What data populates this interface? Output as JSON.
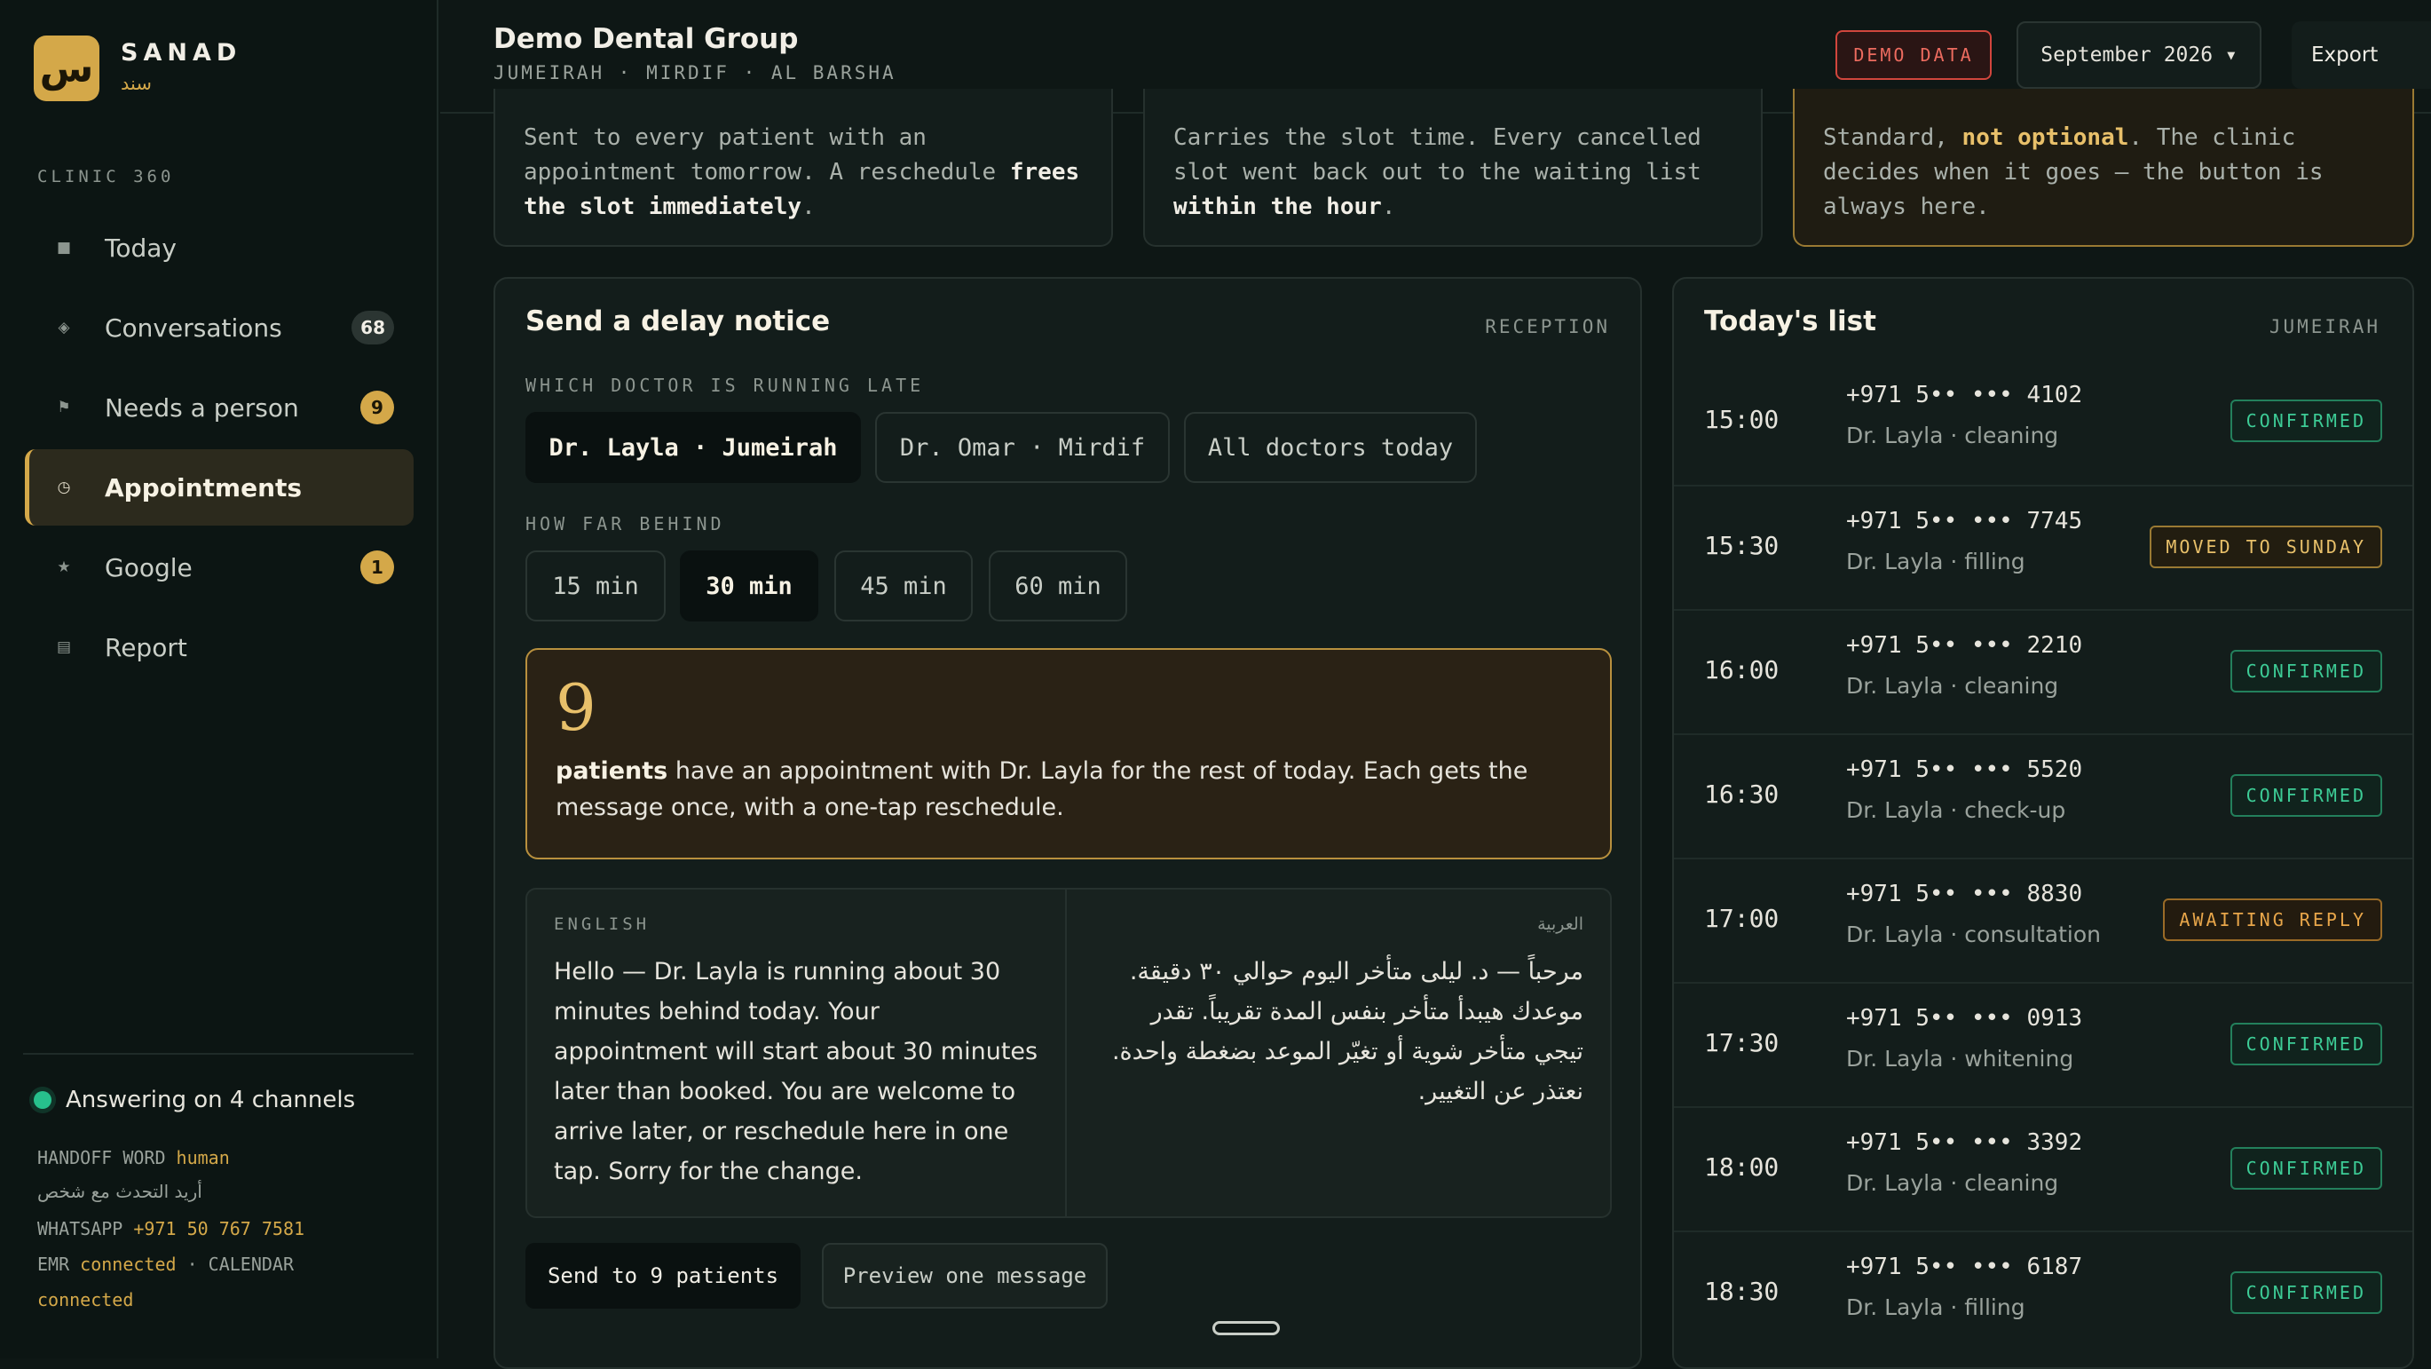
{
  "brand": {
    "logo_glyph": "س",
    "name": "SANAD",
    "name_ar": "سند"
  },
  "sidebar": {
    "section": "CLINIC 360",
    "items": [
      {
        "label": "Today",
        "icon": "square-icon",
        "glyph": "■"
      },
      {
        "label": "Conversations",
        "icon": "diamond-icon",
        "glyph": "◈",
        "badge": "68"
      },
      {
        "label": "Needs a person",
        "icon": "flag-icon",
        "glyph": "⚑",
        "badge": "9"
      },
      {
        "label": "Appointments",
        "icon": "clock-icon",
        "glyph": "◷"
      },
      {
        "label": "Google",
        "icon": "star-icon",
        "glyph": "★",
        "badge": "1"
      },
      {
        "label": "Report",
        "icon": "report-icon",
        "glyph": "▤"
      }
    ],
    "status": "Answering on 4 channels",
    "handoff_label": "HANDOFF WORD",
    "handoff_word": "human",
    "handoff_ar": "أريد التحدث مع شخص",
    "whatsapp_label": "WHATSAPP",
    "whatsapp_number": "+971 50 767 7581",
    "emr_label": "EMR",
    "emr_status": "connected",
    "calendar_label": "· CALENDAR",
    "calendar_status": "connected"
  },
  "header": {
    "org": "Demo Dental Group",
    "locations": "JUMEIRAH · MIRDIF · AL BARSHA",
    "demo_badge": "DEMO DATA",
    "month": "September 2026 ▾",
    "export": "Export"
  },
  "info_cards": [
    {
      "pre": "Sent to every patient with an appointment tomorrow. A reschedule ",
      "bold": "frees the slot immediately",
      "post": "."
    },
    {
      "pre": "Carries the slot time. Every cancelled slot went back out to the waiting list ",
      "bold": "within the hour",
      "post": "."
    },
    {
      "pre": "Standard, ",
      "bold": "not optional",
      "post": ". The clinic decides when it goes — the button is always here."
    }
  ],
  "delay": {
    "title": "Send a delay notice",
    "tag": "RECEPTION",
    "doctor_label": "WHICH DOCTOR IS RUNNING LATE",
    "doctors": [
      "Dr. Layla · Jumeirah",
      "Dr. Omar · Mirdif",
      "All doctors today"
    ],
    "selected_doctor": "Dr. Layla · Jumeirah",
    "behind_label": "HOW FAR BEHIND",
    "delays": [
      "15 min",
      "30 min",
      "45 min",
      "60 min"
    ],
    "selected_delay": "30 min",
    "count": "9",
    "count_bold": "patients",
    "count_text": " have an appointment with Dr. Layla for the rest of today. Each gets the message once, with a one-tap reschedule.",
    "en_label": "ENGLISH",
    "en_body": "Hello — Dr. Layla is running about 30 minutes behind today. Your appointment will start about 30 minutes later than booked. You are welcome to arrive later, or reschedule here in one tap. Sorry for the change.",
    "ar_label": "العربية",
    "ar_body": "مرحباً — د. ليلى متأخر اليوم حوالي ٣٠ دقيقة. موعدك هيبدأ متأخر بنفس المدة تقريباً. تقدر تيجي متأخر شوية أو تغيّر الموعد بضغطة واحدة. نعتذر عن التغيير.",
    "send_button": "Send to 9 patients",
    "preview_button": "Preview one message"
  },
  "today": {
    "title": "Today's list",
    "tag": "JUMEIRAH",
    "rows": [
      {
        "time": "15:00",
        "phone": "+971 5•• ••• 4102",
        "detail": "Dr. Layla · cleaning",
        "status": "CONFIRMED",
        "kind": "confirmed"
      },
      {
        "time": "15:30",
        "phone": "+971 5•• ••• 7745",
        "detail": "Dr. Layla · filling",
        "status": "MOVED TO SUNDAY",
        "kind": "moved"
      },
      {
        "time": "16:00",
        "phone": "+971 5•• ••• 2210",
        "detail": "Dr. Layla · cleaning",
        "status": "CONFIRMED",
        "kind": "confirmed"
      },
      {
        "time": "16:30",
        "phone": "+971 5•• ••• 5520",
        "detail": "Dr. Layla · check-up",
        "status": "CONFIRMED",
        "kind": "confirmed"
      },
      {
        "time": "17:00",
        "phone": "+971 5•• ••• 8830",
        "detail": "Dr. Layla · consultation",
        "status": "AWAITING REPLY",
        "kind": "awaiting"
      },
      {
        "time": "17:30",
        "phone": "+971 5•• ••• 0913",
        "detail": "Dr. Layla · whitening",
        "status": "CONFIRMED",
        "kind": "confirmed"
      },
      {
        "time": "18:00",
        "phone": "+971 5•• ••• 3392",
        "detail": "Dr. Layla · cleaning",
        "status": "CONFIRMED",
        "kind": "confirmed"
      },
      {
        "time": "18:30",
        "phone": "+971 5•• ••• 6187",
        "detail": "Dr. Layla · filling",
        "status": "CONFIRMED",
        "kind": "confirmed"
      }
    ]
  },
  "colors": {
    "accent": "#d4a849",
    "confirmed": "#3dcc96",
    "danger": "#d1463d",
    "background": "#0e1715"
  }
}
